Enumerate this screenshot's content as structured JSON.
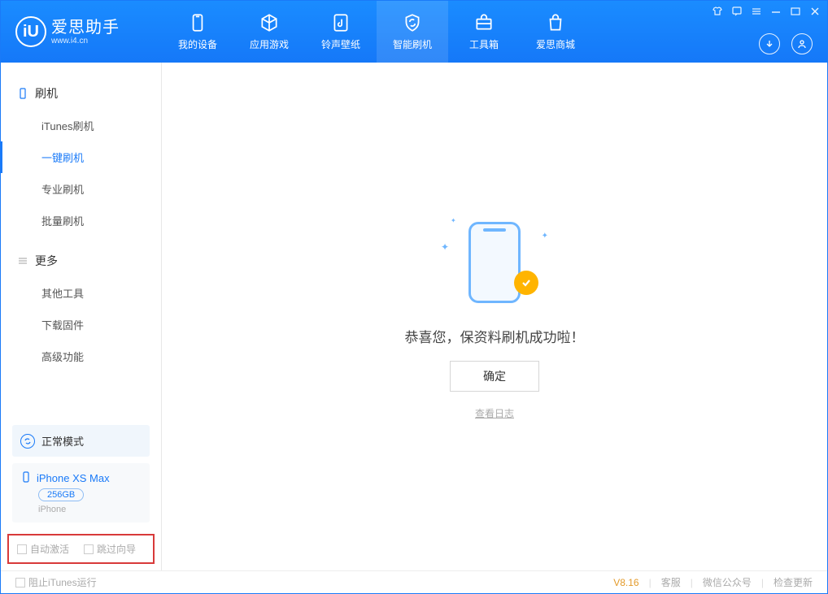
{
  "brand": {
    "name": "爱思助手",
    "site": "www.i4.cn",
    "logo_letter": "iU"
  },
  "nav": [
    {
      "label": "我的设备"
    },
    {
      "label": "应用游戏"
    },
    {
      "label": "铃声壁纸"
    },
    {
      "label": "智能刷机",
      "active": true
    },
    {
      "label": "工具箱"
    },
    {
      "label": "爱思商城"
    }
  ],
  "sidebar": {
    "sections": [
      {
        "title": "刷机",
        "icon": "phone-outline",
        "items": [
          {
            "label": "iTunes刷机"
          },
          {
            "label": "一键刷机",
            "active": true
          },
          {
            "label": "专业刷机"
          },
          {
            "label": "批量刷机"
          }
        ]
      },
      {
        "title": "更多",
        "icon": "menu-lines",
        "items": [
          {
            "label": "其他工具"
          },
          {
            "label": "下载固件"
          },
          {
            "label": "高级功能"
          }
        ]
      }
    ],
    "mode_card": {
      "label": "正常模式"
    },
    "device_card": {
      "name": "iPhone XS Max",
      "storage": "256GB",
      "type": "iPhone"
    },
    "checkboxes": {
      "auto_activate": "自动激活",
      "skip_wizard": "跳过向导"
    }
  },
  "main": {
    "message": "恭喜您，保资料刷机成功啦！",
    "ok_button": "确定",
    "view_log": "查看日志"
  },
  "footer": {
    "block_itunes": "阻止iTunes运行",
    "version": "V8.16",
    "support": "客服",
    "wechat": "微信公众号",
    "update": "检查更新"
  }
}
